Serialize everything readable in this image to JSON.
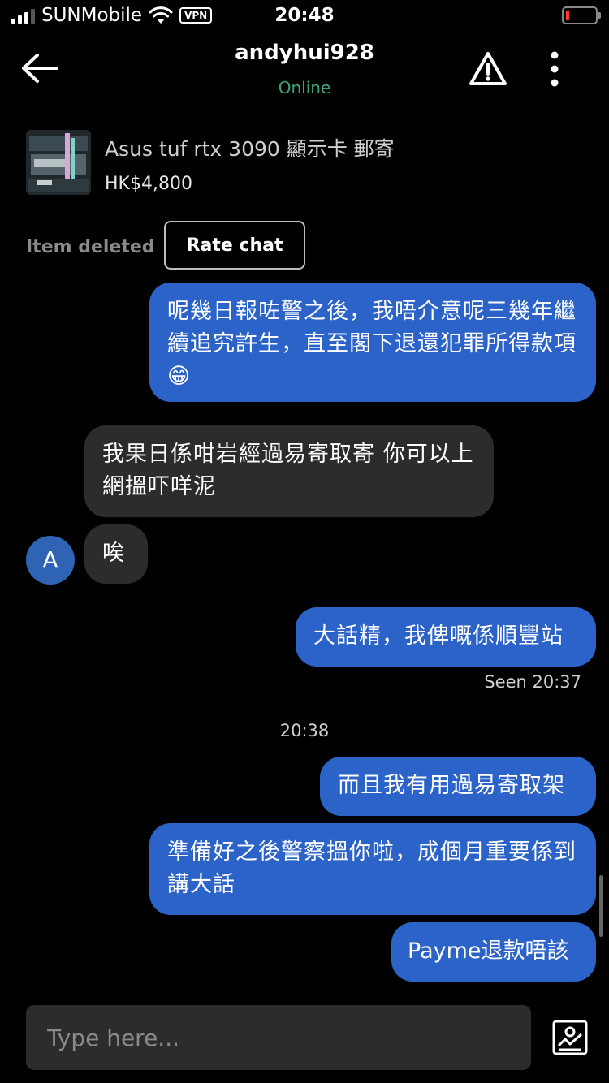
{
  "status_bar": {
    "carrier": "SUNMobile",
    "vpn": "VPN",
    "time": "20:48"
  },
  "header": {
    "username": "andyhui928",
    "status": "Online",
    "status_color": "#3aa57a"
  },
  "listing": {
    "title": "Asus tuf rtx 3090 顯示卡 郵寄",
    "price": "HK$4,800"
  },
  "item_deleted": "Item deleted",
  "rate_chat": "Rate chat",
  "messages": {
    "m1": "呢幾日報咗警之後，我唔介意呢三幾年繼續追究許生，直至閣下退還犯罪所得款項😁",
    "m2": "我果日係咁岩經過易寄取寄 你可以上網搵吓咩泥",
    "m3": "唉",
    "m4": "大話精，我俾嘅係順豐站",
    "m5": "而且我有用過易寄取架",
    "m6": "準備好之後警察搵你啦，成個月重要係到講大話",
    "m7": "Payme退款唔該"
  },
  "avatar_letter": "A",
  "seen": "Seen 20:37",
  "time_separator": "20:38",
  "composer": {
    "placeholder": "Type here..."
  },
  "icons": [
    "back-arrow-icon",
    "warning-icon",
    "more-vertical-icon",
    "photo-icon",
    "wifi-icon",
    "signal-icon",
    "battery-icon"
  ],
  "colors": {
    "outgoing_bubble": "#2b63c9",
    "incoming_bubble": "#2c2c2e",
    "background": "#000000"
  }
}
